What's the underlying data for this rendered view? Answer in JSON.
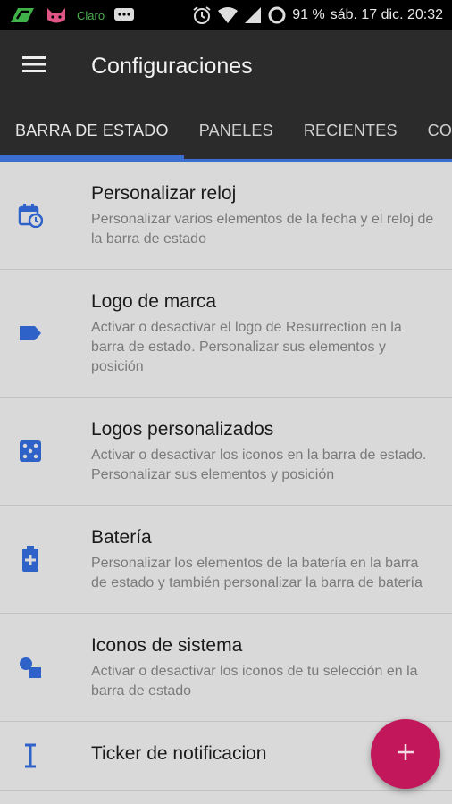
{
  "statusbar": {
    "carrier": "Claro",
    "battery_percent": "91 %",
    "datetime": "sáb. 17 dic. 20:32"
  },
  "toolbar": {
    "title": "Configuraciones"
  },
  "tabs": [
    {
      "label": "BARRA DE ESTADO"
    },
    {
      "label": "PANELES"
    },
    {
      "label": "RECIENTES"
    },
    {
      "label": "CON"
    }
  ],
  "items": [
    {
      "title": "Personalizar reloj",
      "desc": "Personalizar varios elementos de la fecha y el reloj de la barra de estado",
      "icon": "calendar-clock-icon"
    },
    {
      "title": "Logo de marca",
      "desc": "Activar o desactivar el logo de Resurrection en la barra de estado. Personalizar sus elementos y posición",
      "icon": "label-icon"
    },
    {
      "title": "Logos personalizados",
      "desc": "Activar o desactivar los iconos en la barra de estado. Personalizar sus elementos y posición",
      "icon": "dice-icon"
    },
    {
      "title": "Batería",
      "desc": "Personalizar los elementos de la batería en la barra de estado y también personalizar la barra de batería",
      "icon": "battery-plus-icon"
    },
    {
      "title": "Iconos de sistema",
      "desc": "Activar o desactivar los iconos de tu selección en la barra de estado",
      "icon": "shapes-icon"
    },
    {
      "title": "Ticker de notificacion",
      "desc": "",
      "icon": "text-cursor-icon"
    }
  ],
  "colors": {
    "accent": "#3a6fd1",
    "fab": "#c2185b"
  }
}
